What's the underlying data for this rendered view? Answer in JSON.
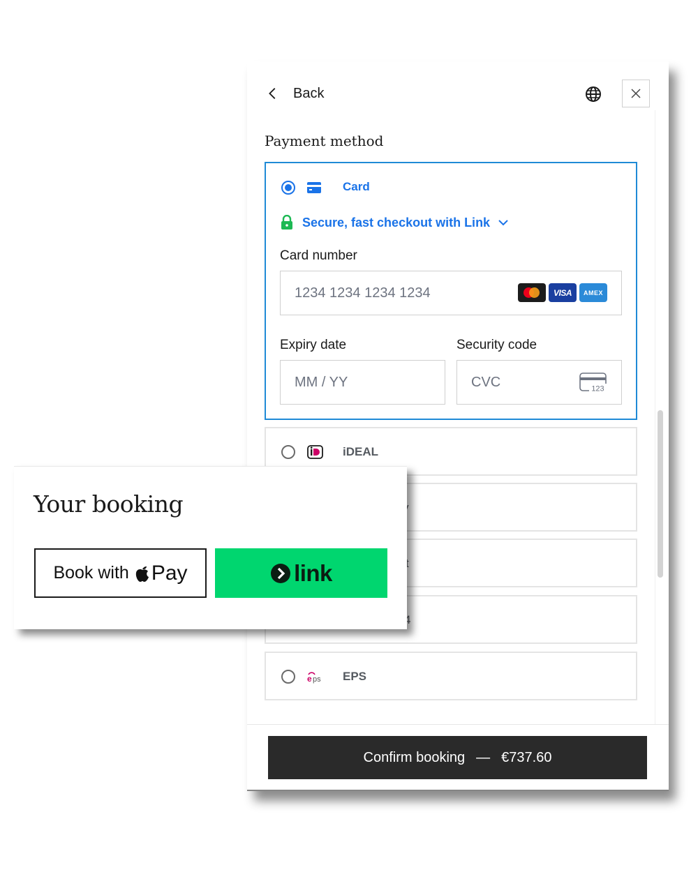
{
  "panel": {
    "back_label": "Back",
    "icons": {
      "back": "chevron-left-icon",
      "language": "globe-icon",
      "close": "close-icon"
    },
    "payment_title": "Payment method",
    "card_option": {
      "label": "Card",
      "selected": true,
      "link_prompt": "Secure, fast checkout with Link",
      "card_number_label": "Card number",
      "card_number_placeholder": "1234 1234 1234 1234",
      "brands": [
        "Mastercard",
        "VISA",
        "AMEX"
      ],
      "expiry_label": "Expiry date",
      "expiry_placeholder": "MM / YY",
      "security_label": "Security code",
      "security_placeholder": "CVC",
      "cvc_icon_text": "123"
    },
    "other_options": [
      {
        "label": "iDEAL",
        "icon": "ideal-icon",
        "peek": ""
      },
      {
        "label": "",
        "icon": "",
        "peek": "y"
      },
      {
        "label": "",
        "icon": "",
        "peek": "t"
      },
      {
        "label": "",
        "icon": "",
        "peek": "4"
      },
      {
        "label": "EPS",
        "icon": "eps-icon",
        "peek": ""
      }
    ],
    "confirm": {
      "label": "Confirm booking",
      "separator": "—",
      "amount": "€737.60"
    }
  },
  "booking": {
    "title": "Your booking",
    "apple_pay": {
      "prefix": "Book with",
      "pay": "Pay"
    },
    "link_button": {
      "word": "link"
    }
  },
  "colors": {
    "accent_blue": "#1a73e8",
    "link_green": "#00d66f",
    "lock_green": "#1db954",
    "confirm_bg": "#2a2a2a"
  }
}
